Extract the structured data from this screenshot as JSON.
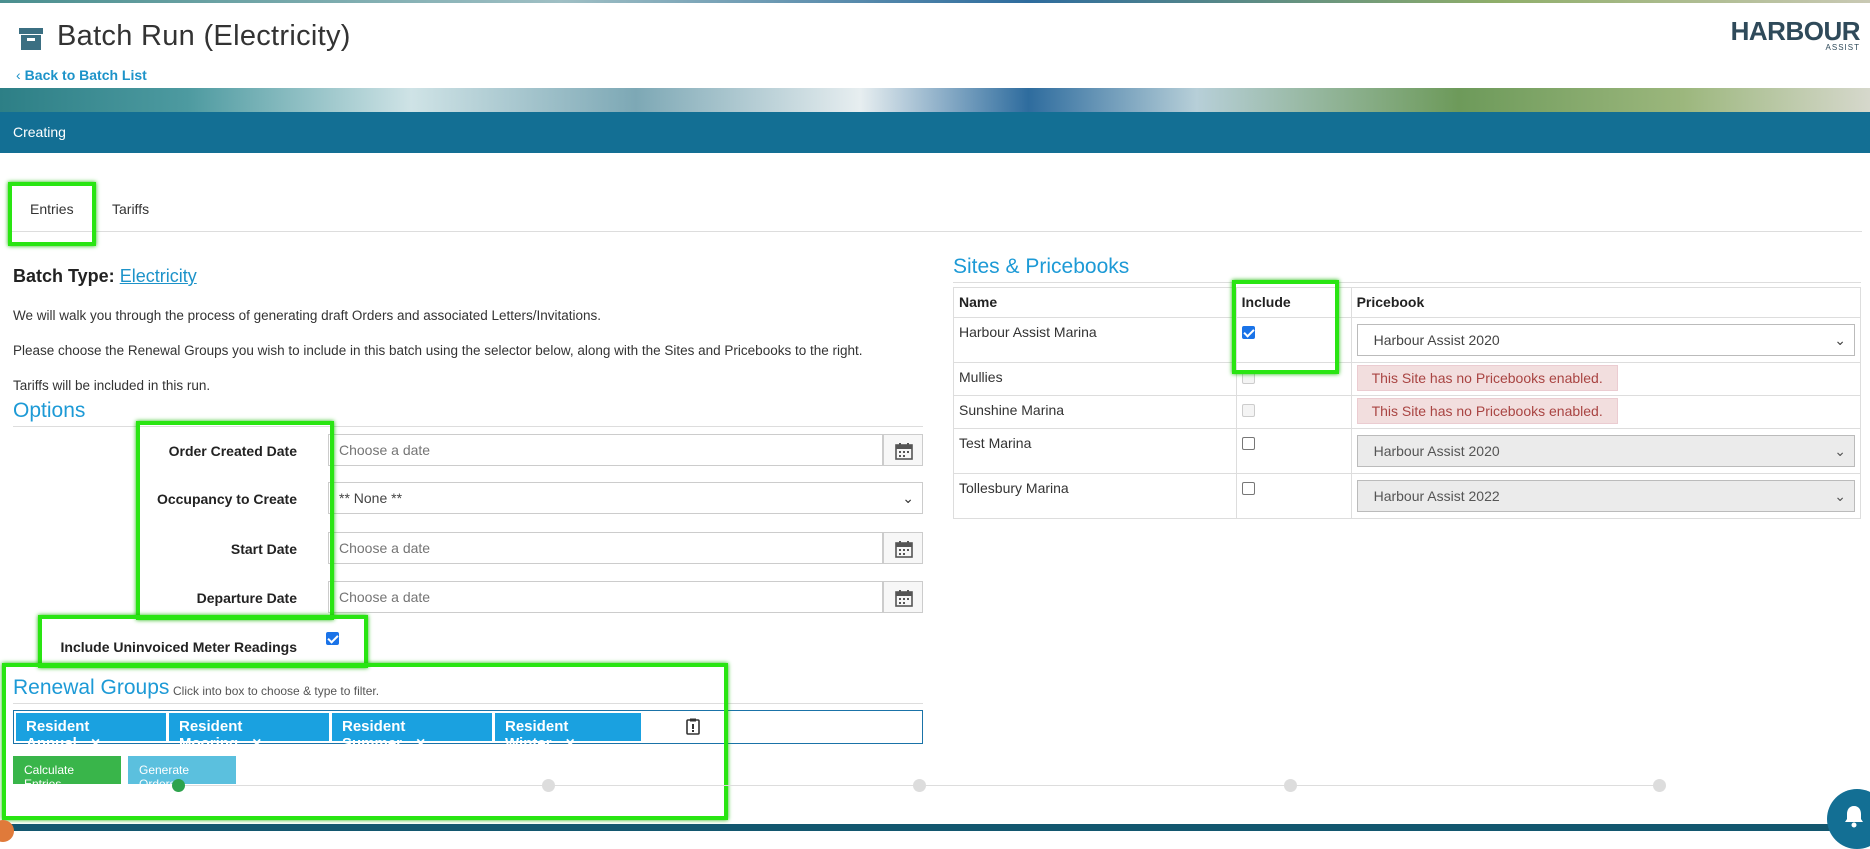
{
  "header": {
    "title": "Batch Run (Electricity)",
    "back_link": "Back to Batch List",
    "logo_main": "HARBOUR",
    "logo_sub": "ASSIST"
  },
  "status_bar": {
    "text": "Creating"
  },
  "tabs": [
    {
      "label": "Entries",
      "active": true
    },
    {
      "label": "Tariffs",
      "active": false
    }
  ],
  "intro": {
    "batch_type_label": "Batch Type:",
    "batch_type_value": "Electricity",
    "para1": "We will walk you through the process of generating draft Orders and associated Letters/Invitations.",
    "para2": "Please choose the Renewal Groups you wish to include in this batch using the selector below, along with the Sites and Pricebooks to the right.",
    "para3": "Tariffs will be included in this run."
  },
  "options": {
    "title": "Options",
    "order_created_label": "Order Created Date",
    "order_created_placeholder": "Choose a date",
    "occupancy_label": "Occupancy to Create",
    "occupancy_value": "** None **",
    "start_label": "Start Date",
    "start_placeholder": "Choose a date",
    "departure_label": "Departure Date",
    "departure_placeholder": "Choose a date",
    "uninvoiced_label": "Include Uninvoiced Meter Readings",
    "uninvoiced_checked": true
  },
  "renewal_groups": {
    "title": "Renewal Groups",
    "hint": "Click into box to choose & type to filter.",
    "tags": [
      "Resident Annual",
      "Resident Mooring",
      "Resident Summer",
      "Resident Winter"
    ],
    "remove_glyph": "×"
  },
  "buttons": {
    "calculate": "Calculate Entries",
    "generate": "Generate Orders"
  },
  "progress": {
    "steps": 5,
    "current": 1
  },
  "sites": {
    "title": "Sites & Pricebooks",
    "headers": {
      "name": "Name",
      "include": "Include",
      "pricebook": "Pricebook"
    },
    "rows": [
      {
        "name": "Harbour Assist Marina",
        "include": true,
        "enabled": true,
        "pricebook": "Harbour Assist 2020",
        "error": ""
      },
      {
        "name": "Mullies",
        "include": false,
        "enabled": false,
        "pricebook": "",
        "error": "This Site has no Pricebooks enabled."
      },
      {
        "name": "Sunshine Marina",
        "include": false,
        "enabled": false,
        "pricebook": "",
        "error": "This Site has no Pricebooks enabled."
      },
      {
        "name": "Test Marina",
        "include": false,
        "enabled": true,
        "pricebook": "Harbour Assist 2020",
        "error": "",
        "disabled_select": true
      },
      {
        "name": "Tollesbury Marina",
        "include": false,
        "enabled": true,
        "pricebook": "Harbour Assist 2022",
        "error": "",
        "disabled_select": true
      }
    ]
  },
  "colors": {
    "brand_teal": "#136f94",
    "link_blue": "#1d93c9",
    "highlight_green": "#29e512",
    "button_green": "#39b54a",
    "button_blue": "#5bc0de",
    "tag_blue": "#1aa1e0",
    "error_red": "#a94442"
  },
  "icons": [
    "archive-icon",
    "chevron-left-icon",
    "calendar-icon",
    "chevron-down-icon",
    "close-icon",
    "clipboard-icon",
    "bell-icon"
  ]
}
